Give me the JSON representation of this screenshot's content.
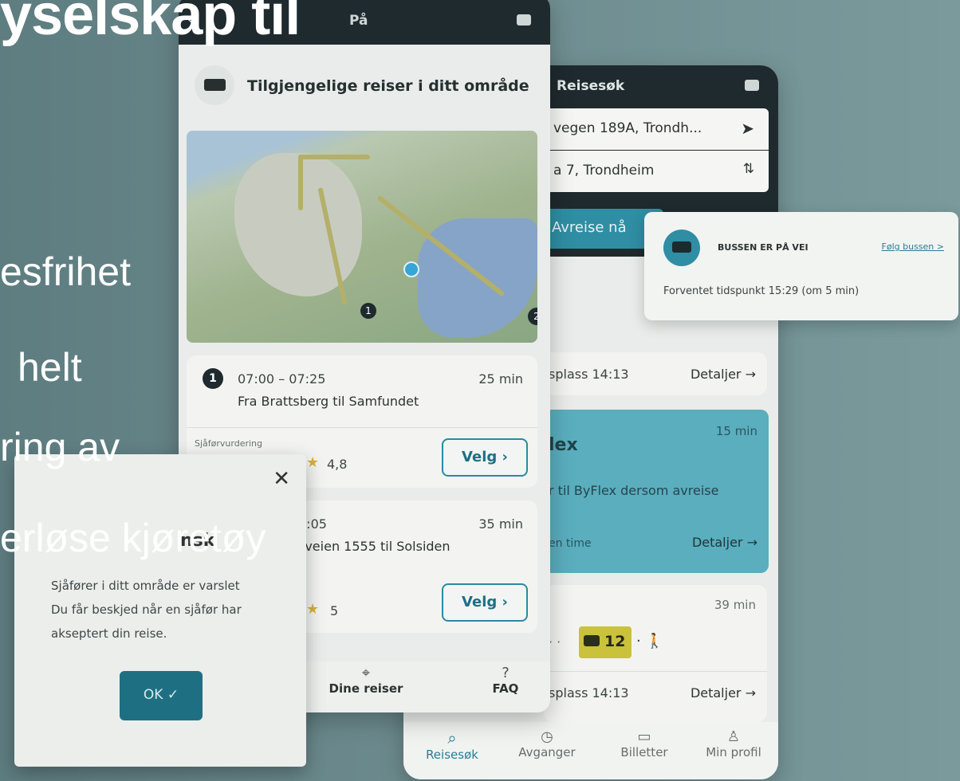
{
  "backdrop": {
    "headline": "yselskap til",
    "bullets": [
      "esfrihet",
      "helt",
      "ring av",
      "erløse kjøretøy"
    ]
  },
  "phone1": {
    "top_label": "På",
    "available_title": "Tilgjengelige reiser i ditt område",
    "trip1": {
      "number": "1",
      "time": "07:00 – 07:25",
      "duration": "25 min",
      "route": "Fra Brattsberg til Samfundet",
      "rating_label": "Sjåførvurdering",
      "rating_value": "4,8",
      "choose_label": "Velg"
    },
    "trip2": {
      "time_partial": "8:05",
      "duration": "35 min",
      "route_partial": "sveien 1555 til Solsiden",
      "rating_value": "5",
      "choose_label": "Velg"
    },
    "nav": {
      "dine_reiser": "Dine reiser",
      "faq": "FAQ"
    }
  },
  "phone2": {
    "title": "Reisesøk",
    "from_field": "vegen 189A, Trondh...",
    "to_field": "a 7, Trondheim",
    "depart_button": "Avreise nå",
    "result1": {
      "stop": "splass 14:13",
      "details": "Detaljer"
    },
    "byflex": {
      "title": "lex",
      "duration": "15 min",
      "text": "r til ByFlex dersom avreise",
      "sub": "en time",
      "details": "Detaljer"
    },
    "result3": {
      "duration": "39 min",
      "bus_number": "12",
      "stop": "splass 14:13",
      "details": "Detaljer"
    },
    "tabs": [
      {
        "label": "Reisesøk",
        "icon": "search-icon"
      },
      {
        "label": "Avganger",
        "icon": "clock-icon"
      },
      {
        "label": "Billetter",
        "icon": "ticket-icon"
      },
      {
        "label": "Min profil",
        "icon": "person-icon"
      }
    ]
  },
  "bus_notice": {
    "title": "BUSSEN ER PÅ VEI",
    "link": "Følg bussen >",
    "eta": "Forventet tidspunkt 15:29 (om 5 min)"
  },
  "dialog": {
    "title_partial": "nsk",
    "line1": "Sjåfører i ditt område er varslet",
    "line2": "Du får beskjed når en sjåfør har",
    "line3": "akseptert din reise.",
    "ok_label": "OK ✓"
  },
  "colors": {
    "teal": "#2f8ea3",
    "dark": "#1f2a2e",
    "byflex": "#5aaebe",
    "bus_badge": "#c9c23a"
  }
}
